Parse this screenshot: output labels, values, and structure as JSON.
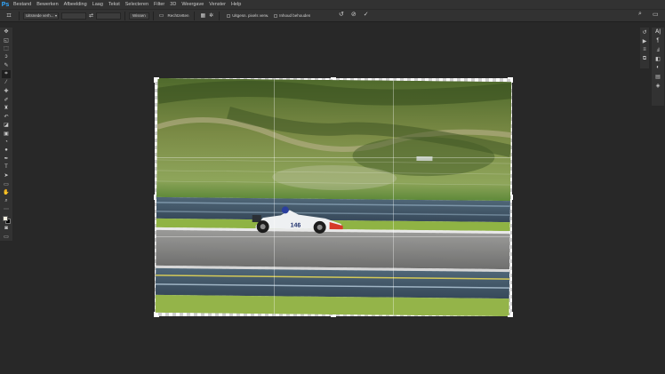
{
  "menu": {
    "app_logo": "Ps",
    "items": [
      "Bestand",
      "Bewerken",
      "Afbeelding",
      "Laag",
      "Tekst",
      "Selecteren",
      "Filter",
      "3D",
      "Weergave",
      "Venster",
      "Help"
    ]
  },
  "options": {
    "ratio_value": "Uitsnede verh...",
    "clear_label": "Wissen",
    "straighten_label": "Rechtzetten",
    "delete_cropped_label": "Uitgesn. pixels verw.",
    "content_aware_label": "Inhoud behouden"
  },
  "canvas": {
    "number_plate": "146"
  },
  "colors": {
    "accent": "#31a8ff",
    "foreground_swatch": "#f3efe0",
    "background_swatch": "#000000"
  }
}
